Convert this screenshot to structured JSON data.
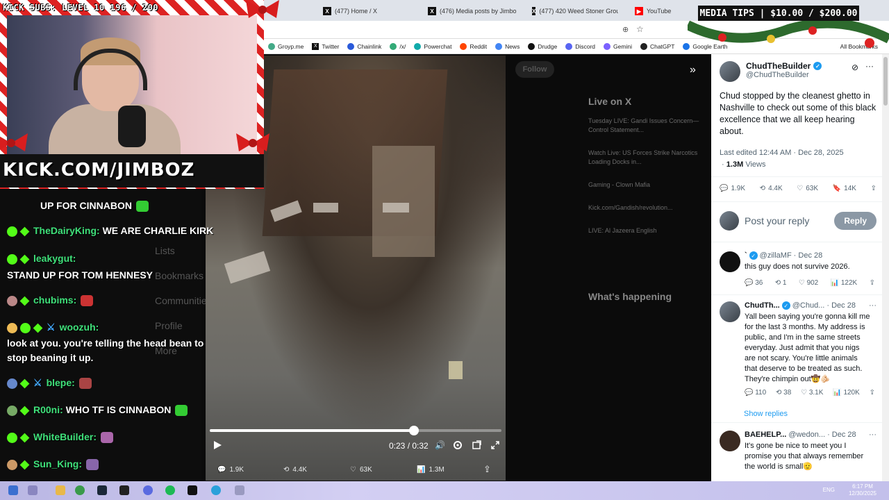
{
  "stream": {
    "kick_subs": "KICK SUBS: LEVEL 10 196 / 200",
    "kick_url": "KICK.COM/JIMBOZ",
    "media_tips": "MEDIA TIPS | $10.00 / $200.00"
  },
  "browser": {
    "tabs": [
      {
        "label": "(477) Home / X"
      },
      {
        "label": "(476) Media posts by Jimbo"
      },
      {
        "label": "(477) 420 Weed Stoner Grou"
      },
      {
        "label": "YouTube"
      }
    ],
    "bookmarks": [
      {
        "label": "Groyp.me",
        "icon": "groyp-icon",
        "color": "#4a8"
      },
      {
        "label": "Twitter",
        "icon": "x-icon",
        "color": "#111"
      },
      {
        "label": "Chainlink",
        "icon": "chainlink-icon",
        "color": "#2a5ada"
      },
      {
        "label": "/x/",
        "icon": "board-icon",
        "color": "#3a7"
      },
      {
        "label": "Powerchat",
        "icon": "powerchat-icon",
        "color": "#1aa"
      },
      {
        "label": "Reddit",
        "icon": "reddit-icon",
        "color": "#ff4500"
      },
      {
        "label": "News",
        "icon": "news-icon",
        "color": "#4285f4"
      },
      {
        "label": "Drudge",
        "icon": "drudge-icon",
        "color": "#111"
      },
      {
        "label": "Discord",
        "icon": "discord-icon",
        "color": "#5865f2"
      },
      {
        "label": "Gemini",
        "icon": "gemini-icon",
        "color": "#7b61ff"
      },
      {
        "label": "ChatGPT",
        "icon": "chatgpt-icon",
        "color": "#222"
      },
      {
        "label": "Google Earth",
        "icon": "earth-icon",
        "color": "#1a73e8"
      }
    ],
    "all_bookmarks": "All Bookmarks"
  },
  "xpage": {
    "live_heading": "Live on X",
    "live_items": [
      "Tuesday LIVE: Gandi Issues Concern—Control Statement...",
      "Watch Live: US Forces Strike Narcotics Loading Docks in...",
      "Gaming - Clown Mafia",
      "Kick.com/Gandish/revolution...",
      "LIVE: Al Jazeera English"
    ],
    "happening_heading": "What's happening",
    "left_nav": [
      "Lists",
      "Bookmarks",
      "Communities",
      "Profile",
      "More"
    ],
    "follow_label": "Follow"
  },
  "video": {
    "current_time": "0:23",
    "duration": "0:32",
    "progress": 0.7,
    "stats": {
      "replies": "1.9K",
      "reposts": "4.4K",
      "likes": "63K",
      "views": "1.3M"
    }
  },
  "tweet": {
    "author_name": "ChudTheBuilder",
    "author_handle": "@ChudTheBuilder",
    "text": "Chud stopped by the cleanest ghetto in Nashville to check out some of this black excellence that we all keep hearing about.",
    "edited": "Last edited 12:44 AM · Dec 28, 2025",
    "views_count": "1.3M",
    "views_label": "Views",
    "replies": "1.9K",
    "reposts": "4.4K",
    "likes": "63K",
    "bookmarks": "14K",
    "reply_placeholder": "Post your reply",
    "reply_button": "Reply",
    "show_replies": "Show replies"
  },
  "replies": [
    {
      "name": "`",
      "handle": "@zillaMF",
      "date": "· Dec 28",
      "text": "this guy does not survive 2026.",
      "replies": "36",
      "reposts": "1",
      "likes": "902",
      "views": "122K"
    },
    {
      "name": "ChudTh...",
      "handle": "@Chud...",
      "date": "· Dec 28",
      "text": "Yall been saying you're gonna kill me for the last 3 months. My address is public, and I'm in the same streets everyday. Just admit that you nigs are not scary. You're little animals that deserve to be treated as such. They're chimpin out🤠🫵🏻",
      "replies": "110",
      "reposts": "38",
      "likes": "3.1K",
      "views": "120K"
    },
    {
      "name": "BAEHELP...",
      "handle": "@wedon...",
      "date": "· Dec 28",
      "text": "It's gone be nice to meet you I promise you that always remember the world is small🫡"
    }
  ],
  "chat": [
    {
      "user": "",
      "text": "UP FOR CINNABON"
    },
    {
      "user": "TheDairyKing:",
      "text": "WE ARE CHARLIE KIRK"
    },
    {
      "user": "leakygut:",
      "text": ""
    },
    {
      "user": "",
      "text": "STAND UP FOR TOM HENNESY"
    },
    {
      "user": "chubims:",
      "text": ""
    },
    {
      "user": "woozuh:",
      "text": ""
    },
    {
      "user": "",
      "text": "look at you. you're telling the head bean to"
    },
    {
      "user": "",
      "text": "stop beaning it up."
    },
    {
      "user": "blepe:",
      "text": ""
    },
    {
      "user": "R00ni:",
      "text": "WHO TF IS CINNABON"
    },
    {
      "user": "WhiteBuilder:",
      "text": ""
    },
    {
      "user": "Sun_King:",
      "text": ""
    }
  ],
  "taskbar": {
    "lang": "ENG",
    "time": "6:17 PM",
    "date": "12/30/2025"
  }
}
